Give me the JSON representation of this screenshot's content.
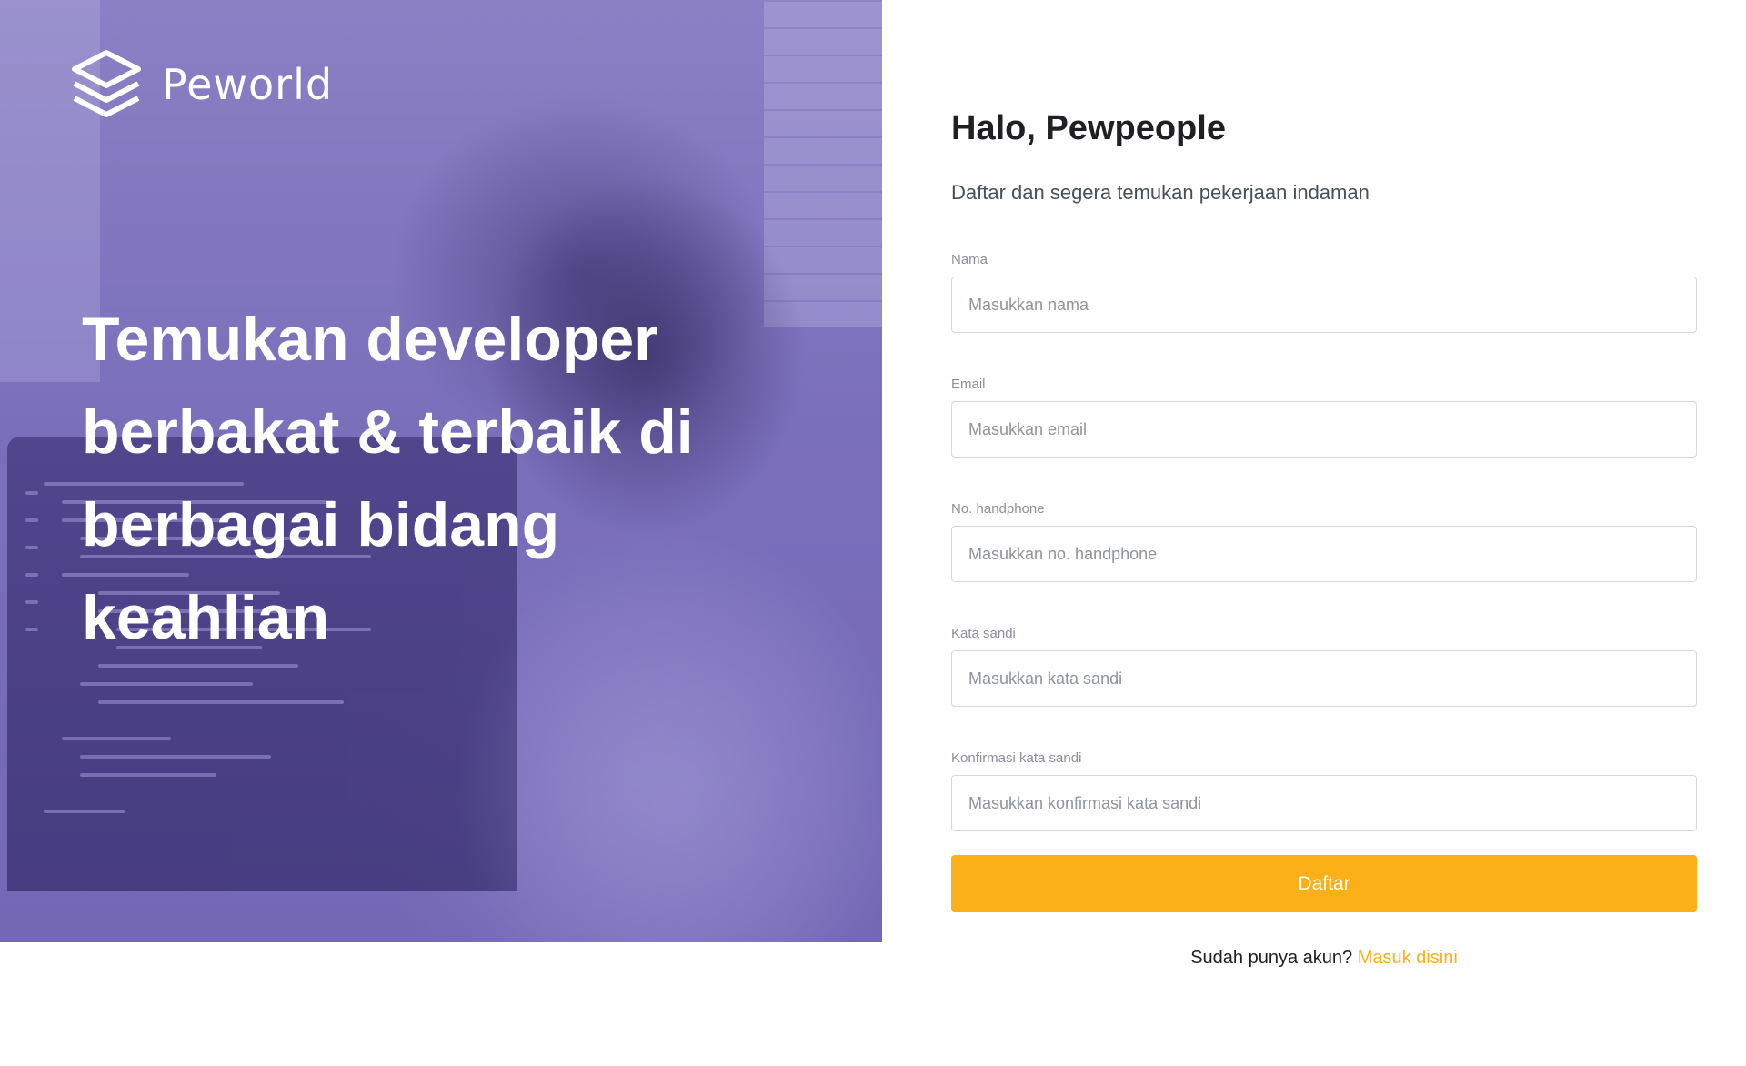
{
  "brand": {
    "name": "Peworld",
    "icon": "layers-icon"
  },
  "hero": {
    "headline": "Temukan developer berbakat & terbaik di berbagai bidang keahlian",
    "overlay_color": "#7e74c0"
  },
  "form": {
    "title": "Halo, Pewpeople",
    "subtitle": "Daftar dan segera temukan pekerjaan indaman",
    "fields": [
      {
        "label": "Nama",
        "placeholder": "Masukkan nama"
      },
      {
        "label": "Email",
        "placeholder": "Masukkan email"
      },
      {
        "label": "No. handphone",
        "placeholder": "Masukkan no. handphone"
      },
      {
        "label": "Kata sandi",
        "placeholder": "Masukkan kata sandi"
      },
      {
        "label": "Konfirmasi kata sandi",
        "placeholder": "Masukkan konfirmasi kata sandi"
      }
    ],
    "submit_label": "Daftar",
    "login_prompt": "Sudah punya akun?",
    "login_link": "Masuk disini"
  },
  "colors": {
    "accent": "#fbb017",
    "text": "#1f2024",
    "muted": "#8b8f99"
  }
}
